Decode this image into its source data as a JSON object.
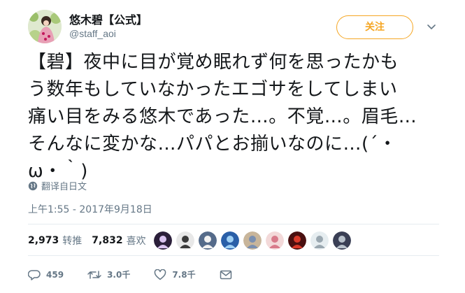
{
  "author": {
    "display_name": "悠木碧【公式】",
    "handle": "@staff_aoi"
  },
  "follow_button": {
    "label": "关注"
  },
  "tweet": {
    "text": "【碧】夜中に目が覚め眠れず何を思ったかもう数年もしていなかったエゴサをしてしまい痛い目をみる悠木であった…。不覚…。眉毛…そんなに変かな…パパとお揃いなのに…(´・ω・｀)",
    "text_lines": [
      "【碧】夜中に目が覚め眠れず何を思ったかも",
      "う数年もしていなかったエゴサをしてしまい",
      "痛い目をみる悠木であった…。不覚…。眉毛…",
      "そんなに変かな…パパとお揃いなのに…(´・",
      "ω・｀)"
    ],
    "translate_label": "翻译自日文",
    "timestamp": "上午1:55 - 2017年9月18日"
  },
  "stats": {
    "retweets_count": "2,973",
    "retweets_label": "转推",
    "likes_count": "7,832",
    "likes_label": "喜欢"
  },
  "likers": [
    {
      "color": "#2b1f3a",
      "accent": "#d9c3f0"
    },
    {
      "color": "#e8e8e8",
      "accent": "#3a3a3a"
    },
    {
      "color": "#556b8a",
      "accent": "#f2f2f2"
    },
    {
      "color": "#2a5fa8",
      "accent": "#9fd0f5"
    },
    {
      "color": "#c8b59a",
      "accent": "#7a8fb0"
    },
    {
      "color": "#f3d9d9",
      "accent": "#d87a8a"
    },
    {
      "color": "#4a1010",
      "accent": "#d93a2a"
    },
    {
      "color": "#e6edf0",
      "accent": "#9aa7b0"
    },
    {
      "color": "#3a3f55",
      "accent": "#b9c2cc"
    }
  ],
  "actions": {
    "reply_count": "459",
    "retweet_count": "3.0千",
    "like_count": "7.8千"
  },
  "colors": {
    "follow_accent": "#f5a623",
    "secondary_text": "#657786",
    "divider": "#e6ecf0"
  }
}
